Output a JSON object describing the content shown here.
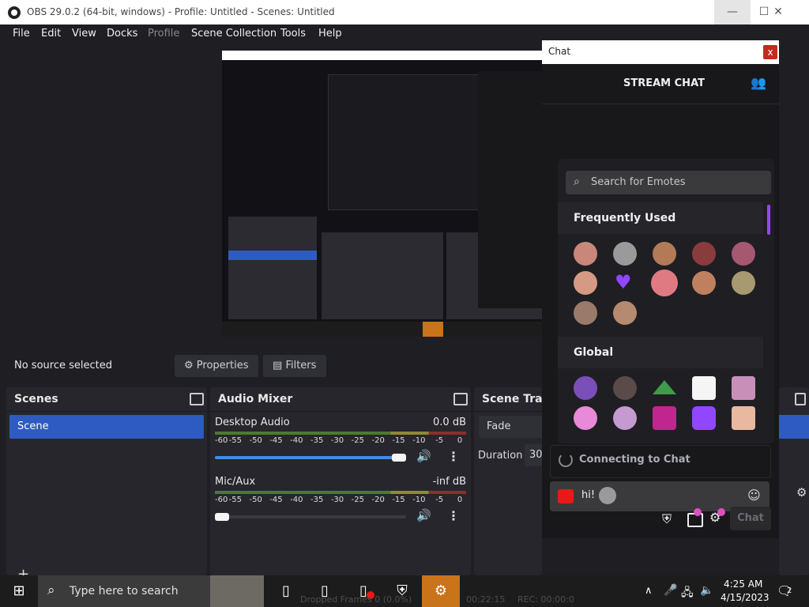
{
  "window": {
    "title": "OBS 29.0.2 (64-bit, windows) - Profile: Untitled - Scenes: Untitled",
    "minimize_glyph": "—",
    "maximize_glyph": "☐",
    "close_glyph": "✕"
  },
  "menu": {
    "items": [
      "File",
      "Edit",
      "View",
      "Docks",
      "Profile",
      "Scene Collection",
      "Tools",
      "Help"
    ]
  },
  "source_bar": {
    "status": "No source selected",
    "properties_label": "Properties",
    "filters_label": "Filters"
  },
  "scenes": {
    "title": "Scenes",
    "items": [
      "Scene"
    ]
  },
  "audio_mixer": {
    "title": "Audio Mixer",
    "scale": [
      "-60",
      "-55",
      "-50",
      "-45",
      "-40",
      "-35",
      "-30",
      "-25",
      "-20",
      "-15",
      "-10",
      "-5",
      "0"
    ],
    "channels": [
      {
        "name": "Desktop Audio",
        "level": "0.0 dB",
        "volume": 1.0
      },
      {
        "name": "Mic/Aux",
        "level": "-inf dB",
        "volume": 0.0
      }
    ]
  },
  "scene_transitions": {
    "title": "Scene Tran",
    "transition": "Fade",
    "duration_label": "Duration",
    "duration_value": "30"
  },
  "chat": {
    "window_title": "Chat",
    "close_glyph": "x",
    "header": "STREAM CHAT",
    "search_placeholder": "Search for Emotes",
    "frequently_used": "Frequently Used",
    "global": "Global",
    "connecting": "Connecting to Chat",
    "input_value": "hi!",
    "chat_button": "Chat"
  },
  "taskbar": {
    "search_placeholder": "Type here to search",
    "time": "4:25 AM",
    "date": "4/15/2023",
    "notifications": "2",
    "hidden_status": "Dropped Frames 0 (0.0%)",
    "status_timer": "00:22:15",
    "rec_label": "REC: 00:00:0"
  },
  "colors": {
    "accent": "#2d5bc2",
    "chat_bg": "#18181b",
    "twitch_purple": "#9147ff",
    "record_red": "#e91916"
  }
}
